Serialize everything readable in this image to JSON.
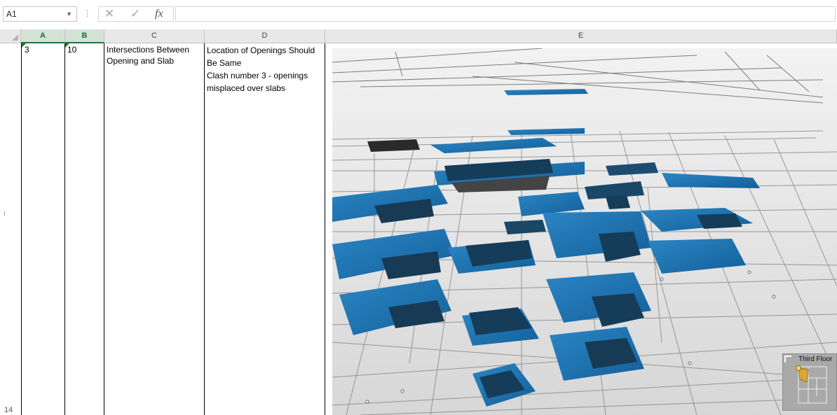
{
  "formula_bar": {
    "name_box": "A1",
    "cancel_glyph": "✕",
    "enter_glyph": "✓",
    "fx_label": "fx",
    "formula_value": ""
  },
  "grid": {
    "columns": [
      "A",
      "B",
      "C",
      "D",
      "E"
    ],
    "row_label_bottom": "14",
    "row": {
      "a": "3",
      "b": "10",
      "c": "Intersections Between Opening and Slab",
      "d_line1": "Location of Openings Should Be Same",
      "d_line2": "Clash number 3 - openings misplaced over slabs"
    }
  },
  "viewport": {
    "minimap_label": "Third Floor",
    "slab_color": "#1a6fa8",
    "slab_dark": "#0f3f60"
  }
}
